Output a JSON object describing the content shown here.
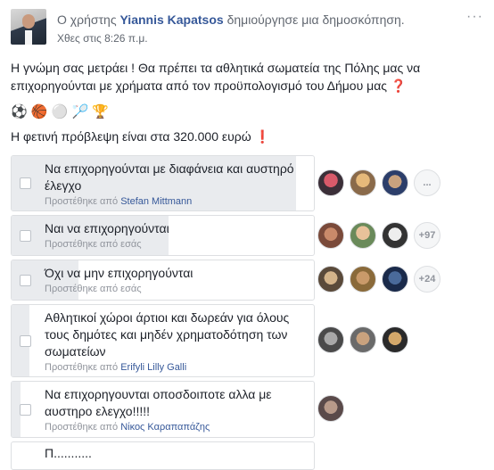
{
  "post": {
    "user_prefix": "Ο χρήστης",
    "author": "Yiannis Kapatsos",
    "action": "δημιούργησε μια δημοσκόπηση.",
    "timestamp": "Χθες στις 8:26 π.μ.",
    "more_icon": "···",
    "text": "Η γνώμη σας μετράει ! Θα πρέπει τα αθλητικά σωματεία της Πόλης μας να επιχορηγούνται με χρήματα από τον προϋπολογισμό του Δήμου μας",
    "emojis": "⚽ 🏀 ⚪ 🏸 🏆",
    "forecast": "Η φετινή πρόβλεψη είναι στα 320.000 ευρώ",
    "question_icon": "❓",
    "exclamation_icon": "❗"
  },
  "poll": {
    "options": [
      {
        "label": "Να επιχορηγούνται με διαφάνεια και αυστηρό έλεγχο",
        "added_prefix": "Προστέθηκε από",
        "added_by": "Stefan Mittmann",
        "more_votes": "...",
        "vote_fraction": 0.94
      },
      {
        "label": "Ναι να επιχορηγούνται",
        "added_prefix": "Προστέθηκε από εσάς",
        "added_by": "",
        "more_votes": "+97",
        "vote_fraction": 0.52
      },
      {
        "label": "Όχι να μην επιχορηγούνται",
        "added_prefix": "Προστέθηκε από εσάς",
        "added_by": "",
        "more_votes": "+24",
        "vote_fraction": 0.22
      },
      {
        "label": "Αθλητικοί χώροι άρτιοι και δωρεάν για όλους τους δημότες και μηδέν χρηματοδότηση των σωματείων",
        "added_prefix": "Προστέθηκε από",
        "added_by": "Erifyli Lilly Galli",
        "more_votes": "",
        "vote_fraction": 0.06
      },
      {
        "label": "Να επιχορηγουνται οποσδοιποτε αλλα με αυστηρο ελεγχο!!!!!",
        "added_prefix": "Προστέθηκε από",
        "added_by": "Νίκος Καραπαπάζης",
        "more_votes": "",
        "vote_fraction": 0.03
      },
      {
        "label": "Π...........",
        "added_prefix": "",
        "added_by": "",
        "more_votes": "",
        "vote_fraction": 0.0
      }
    ]
  }
}
